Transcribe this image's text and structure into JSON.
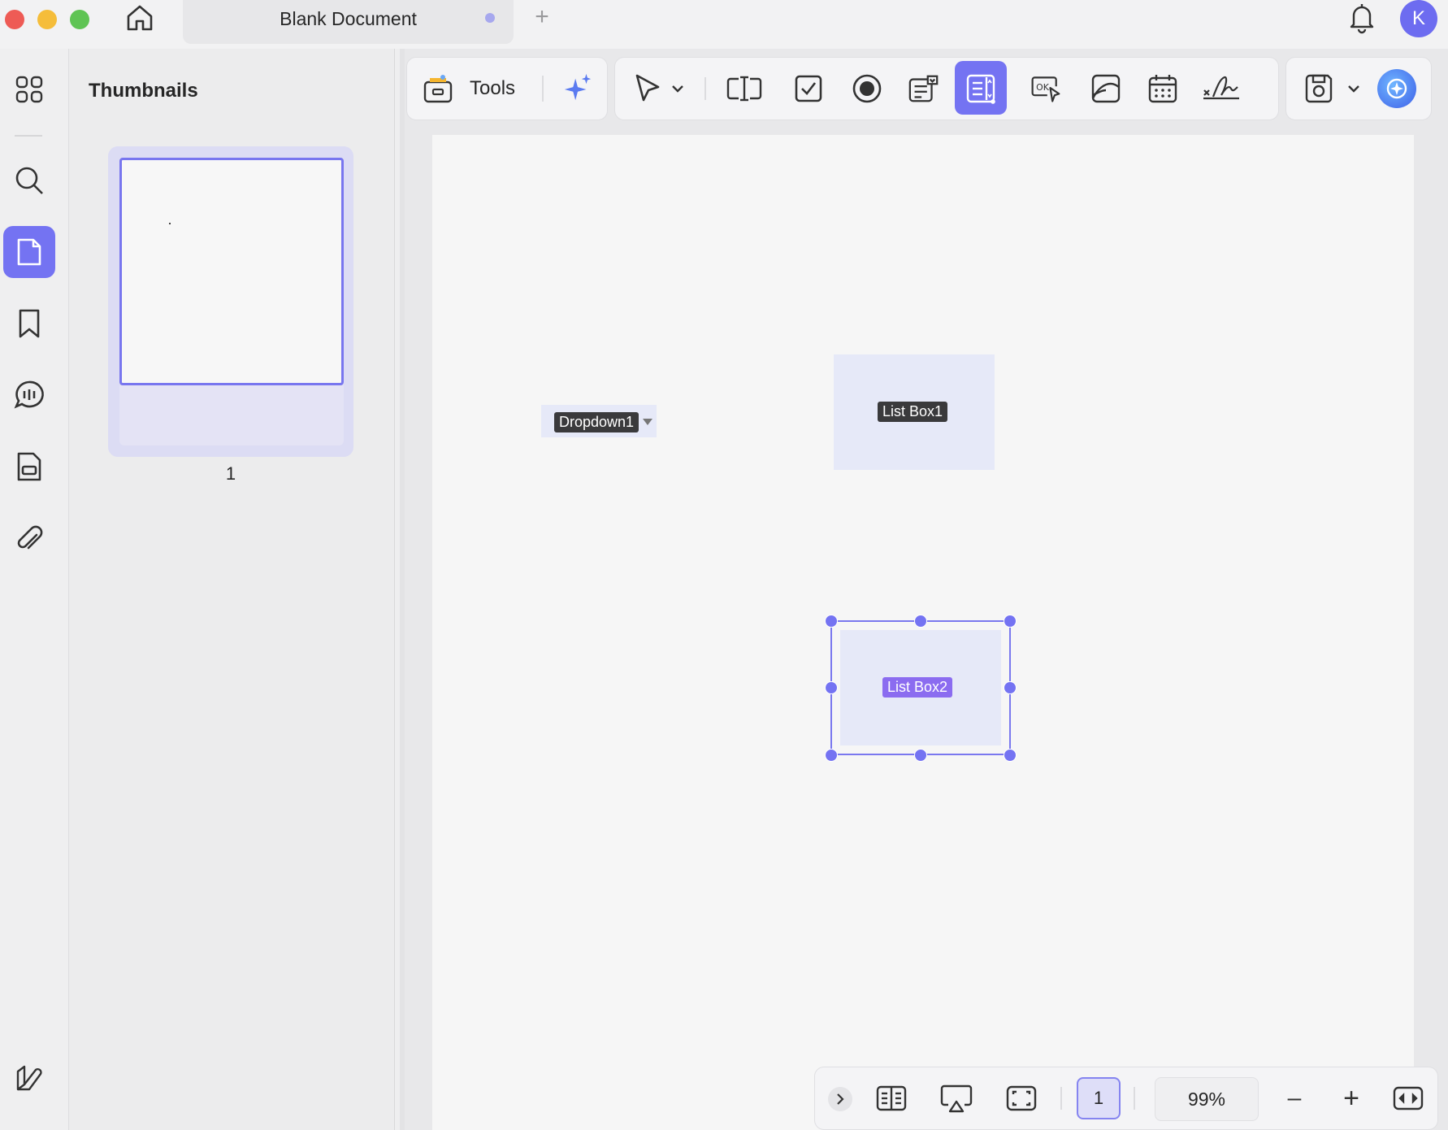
{
  "window": {
    "tab_title": "Blank Document",
    "new_tab_symbol": "+",
    "avatar_letter": "K",
    "traffic_colors": {
      "close": "#ee5b55",
      "minimize": "#f5bd3a",
      "maximize": "#5fc454"
    }
  },
  "sidebar": {
    "items": [
      {
        "icon": "grid-icon"
      },
      {
        "icon": "search-icon"
      },
      {
        "icon": "page-icon",
        "active": true
      },
      {
        "icon": "bookmark-icon"
      },
      {
        "icon": "comment-icon"
      },
      {
        "icon": "form-icon"
      },
      {
        "icon": "attachment-icon"
      }
    ],
    "bottom_icon": "sidebar-toggle-icon"
  },
  "thumbnails": {
    "title": "Thumbnails",
    "pages": [
      {
        "number": "1",
        "selected": true
      }
    ]
  },
  "toolbar": {
    "tools_label": "Tools",
    "icons": [
      "ai-sparkle-icon",
      "select-cursor-icon",
      "chevron-down-icon",
      "text-field-icon",
      "checkbox-icon",
      "radio-button-icon",
      "combo-box-icon",
      "list-box-icon",
      "button-ok-icon",
      "image-field-icon",
      "date-field-icon",
      "signature-field-icon",
      "save-form-icon",
      "chevron-down-icon",
      "ai-assistant-icon"
    ],
    "active_tool": "list-box-icon"
  },
  "document": {
    "fields": [
      {
        "label": "Dropdown1",
        "type": "dropdown",
        "label_color": "#3a3a3c"
      },
      {
        "label": "List Box1",
        "type": "listbox",
        "label_color": "#3a3a3c"
      },
      {
        "label": "List Box2",
        "type": "listbox",
        "selected": true,
        "label_color": "#8b6cf0"
      }
    ]
  },
  "bottom_bar": {
    "page_number": "1",
    "zoom": "99%",
    "zoom_out_symbol": "–",
    "zoom_in_symbol": "+"
  },
  "colors": {
    "accent": "#7473f2"
  }
}
